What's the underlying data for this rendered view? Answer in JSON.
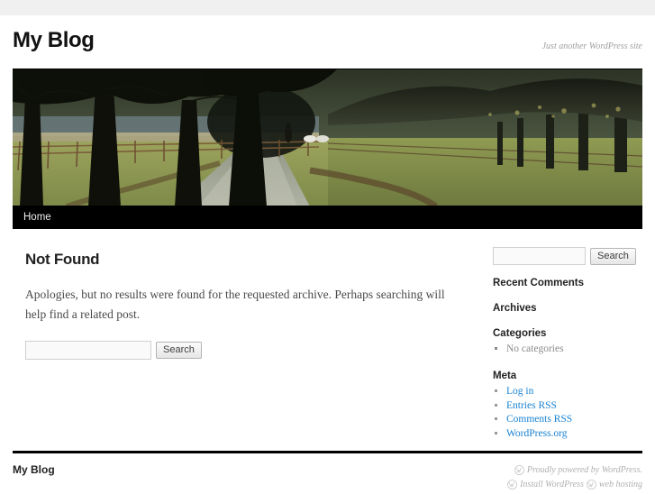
{
  "site": {
    "title": "My Blog",
    "description": "Just another WordPress site"
  },
  "nav": {
    "items": [
      {
        "label": "Home",
        "name": "nav-item-home"
      }
    ]
  },
  "header_image": {
    "alt": "Tree-lined country lane with wooden fence and a walking figure"
  },
  "content": {
    "page_title": "Not Found",
    "body": "Apologies, but no results were found for the requested archive. Perhaps searching will help find a related post.",
    "search": {
      "value": "",
      "placeholder": "",
      "button_label": "Search"
    }
  },
  "sidebar": {
    "search": {
      "value": "",
      "placeholder": "",
      "button_label": "Search"
    },
    "widgets": [
      {
        "title": "Recent Comments",
        "items": []
      },
      {
        "title": "Archives",
        "items": []
      },
      {
        "title": "Categories",
        "items": [
          {
            "label": "No categories",
            "link": false
          }
        ]
      },
      {
        "title": "Meta",
        "items": [
          {
            "label": "Log in",
            "link": true
          },
          {
            "label": "Entries RSS",
            "link": true
          },
          {
            "label": "Comments RSS",
            "link": true
          },
          {
            "label": "WordPress.org",
            "link": true
          }
        ]
      }
    ]
  },
  "footer": {
    "site_title": "My Blog",
    "credit_line_1": "Proudly powered by WordPress.",
    "credit_install": "Install WordPress",
    "credit_hosting": "web hosting"
  },
  "colors": {
    "link": "#1982d1",
    "nav_bg": "#000000",
    "top_strip": "#f0f0f0",
    "muted": "#b0b0b0"
  }
}
